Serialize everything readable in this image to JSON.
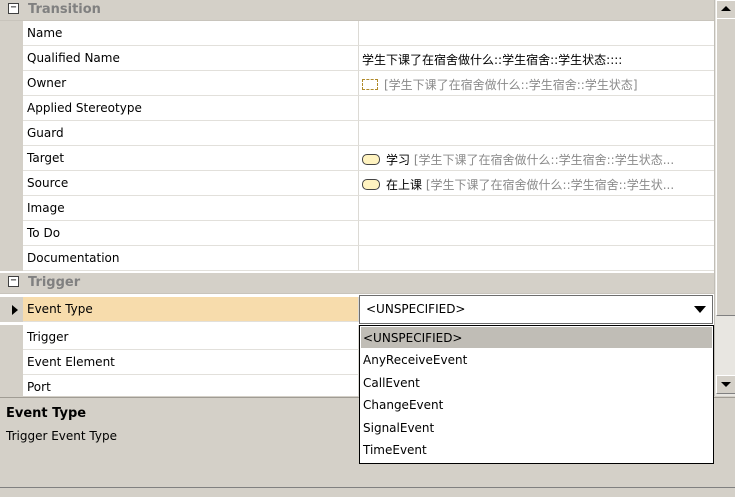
{
  "sections": {
    "transition": "Transition",
    "trigger": "Trigger"
  },
  "transition_rows": [
    {
      "name": "Name",
      "value": "",
      "value_gray": ""
    },
    {
      "name": "Qualified Name",
      "value": "学生下课了在宿舍做什么::学生宿舍::学生状态::::",
      "value_gray": ""
    },
    {
      "name": "Owner",
      "value": "",
      "value_gray": "[学生下课了在宿舍做什么::学生宿舍::学生状态]"
    },
    {
      "name": "Applied Stereotype",
      "value": "",
      "value_gray": ""
    },
    {
      "name": "Guard",
      "value": "",
      "value_gray": ""
    },
    {
      "name": "Target",
      "value": "学习",
      "value_gray": "[学生下课了在宿舍做什么::学生宿舍::学生状态..."
    },
    {
      "name": "Source",
      "value": "在上课",
      "value_gray": "[学生下课了在宿舍做什么::学生宿舍::学生状..."
    },
    {
      "name": "Image",
      "value": "",
      "value_gray": ""
    },
    {
      "name": "To Do",
      "value": "",
      "value_gray": ""
    },
    {
      "name": "Documentation",
      "value": "",
      "value_gray": ""
    }
  ],
  "trigger_rows": [
    {
      "name": "Event Type"
    },
    {
      "name": "Trigger"
    },
    {
      "name": "Event Element"
    },
    {
      "name": "Port"
    }
  ],
  "event_type_combo": {
    "selected": "<UNSPECIFIED>",
    "options": [
      "<UNSPECIFIED>",
      "AnyReceiveEvent",
      "CallEvent",
      "ChangeEvent",
      "SignalEvent",
      "TimeEvent"
    ]
  },
  "description": {
    "title": "Event Type",
    "text": "Trigger Event Type"
  },
  "icons": {
    "section_toggle": "collapse-minus-icon",
    "owner": "package-icon",
    "target": "state-icon",
    "source": "state-icon",
    "current_row": "current-row-arrow-icon"
  }
}
